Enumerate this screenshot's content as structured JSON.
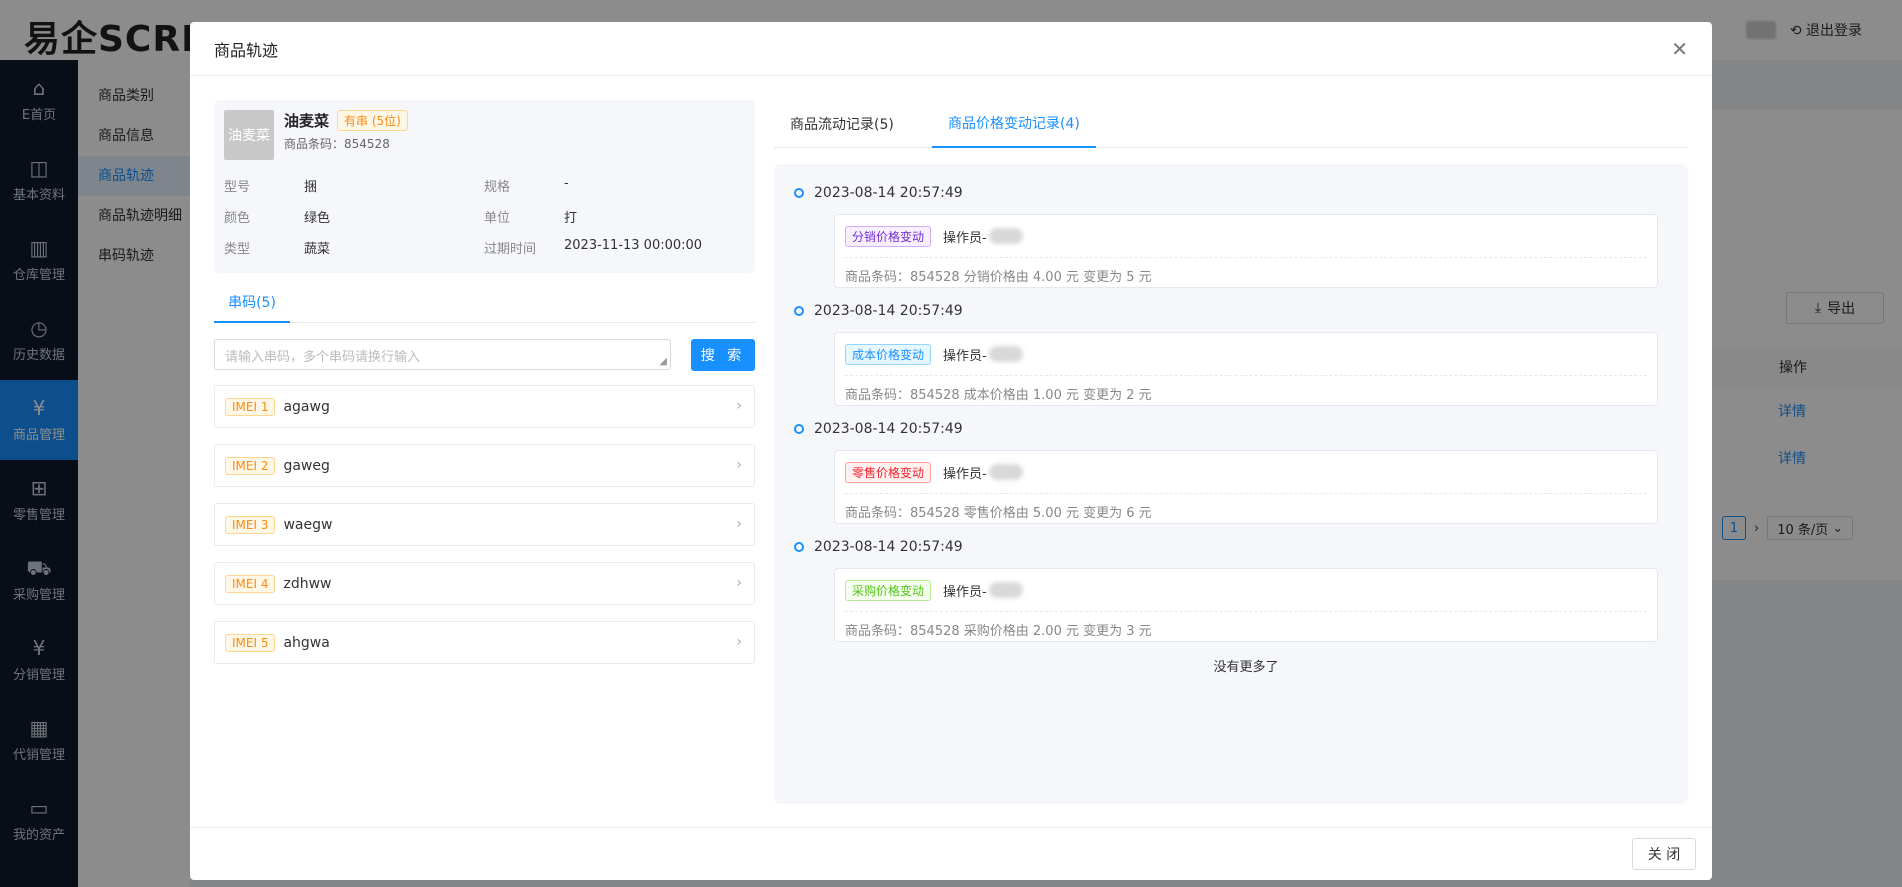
{
  "app": {
    "logo": "易企SCRM",
    "logout": "退出登录",
    "sidebar": [
      {
        "label": "E首页",
        "icon": "home-icon"
      },
      {
        "label": "基本资料",
        "icon": "bag-icon"
      },
      {
        "label": "仓库管理",
        "icon": "bar-chart-icon"
      },
      {
        "label": "历史数据",
        "icon": "clock-icon"
      },
      {
        "label": "商品管理",
        "icon": "yen-circle-icon"
      },
      {
        "label": "零售管理",
        "icon": "retail-icon"
      },
      {
        "label": "采购管理",
        "icon": "cart-icon"
      },
      {
        "label": "分销管理",
        "icon": "distribution-icon"
      },
      {
        "label": "代销管理",
        "icon": "calendar-icon"
      },
      {
        "label": "我的资产",
        "icon": "wallet-icon"
      }
    ],
    "subnav": [
      "商品类别",
      "商品信息",
      "商品轨迹",
      "商品轨迹明细",
      "串码轨迹"
    ],
    "background": {
      "export": "导出",
      "col_action": "操作",
      "detail1": "详情",
      "detail2": "详情",
      "page": "1",
      "page_size": "10 条/页"
    }
  },
  "modal": {
    "title": "商品轨迹",
    "close_label": "关 闭",
    "goods": {
      "thumb_text": "油麦菜",
      "name": "油麦菜",
      "serial_tag": "有串 (5位)",
      "code_label": "商品条码：",
      "code": "854528",
      "attrs": {
        "model_label": "型号",
        "model": "捆",
        "spec_label": "规格",
        "spec": "-",
        "color_label": "颜色",
        "color": "绿色",
        "unit_label": "单位",
        "unit": "打",
        "type_label": "类型",
        "type": "蔬菜",
        "expire_label": "过期时间",
        "expire": "2023-11-13 00:00:00"
      }
    },
    "serial_tab": "串码(5)",
    "serial_placeholder": "请输入串码，多个串码请换行输入",
    "search_label": "搜 索",
    "imei": [
      {
        "tag": "IMEI 1",
        "value": "agawg"
      },
      {
        "tag": "IMEI 2",
        "value": "gaweg"
      },
      {
        "tag": "IMEI 3",
        "value": "waegw"
      },
      {
        "tag": "IMEI 4",
        "value": "zdhww"
      },
      {
        "tag": "IMEI 5",
        "value": "ahgwa"
      }
    ],
    "tabs": {
      "flow": "商品流动记录(5)",
      "price": "商品价格变动记录(4)"
    },
    "records": [
      {
        "time": "2023-08-14 20:57:49",
        "tag": "分销价格变动",
        "operator": "操作员-",
        "detail": "商品条码：854528 分销价格由 4.00 元 变更为 5 元"
      },
      {
        "time": "2023-08-14 20:57:49",
        "tag": "成本价格变动",
        "operator": "操作员-",
        "detail": "商品条码：854528 成本价格由 1.00 元 变更为 2 元"
      },
      {
        "time": "2023-08-14 20:57:49",
        "tag": "零售价格变动",
        "operator": "操作员-",
        "detail": "商品条码：854528 零售价格由 5.00 元 变更为 6 元"
      },
      {
        "time": "2023-08-14 20:57:49",
        "tag": "采购价格变动",
        "operator": "操作员-",
        "detail": "商品条码：854528 采购价格由 2.00 元 变更为 3 元"
      }
    ],
    "no_more": "没有更多了"
  }
}
